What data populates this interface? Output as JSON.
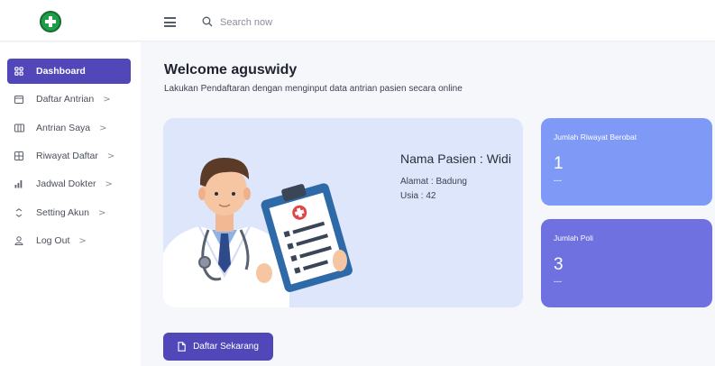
{
  "header": {
    "logo_icon": "medical-cross-logo",
    "menu_icon": "hamburger-icon",
    "search": {
      "placeholder": "Search now",
      "value": ""
    }
  },
  "sidebar": {
    "items": [
      {
        "label": "Dashboard",
        "icon": "grid-icon",
        "active": true
      },
      {
        "label": "Daftar Antrian",
        "icon": "calendar-icon",
        "chevron": ">"
      },
      {
        "label": "Antrian Saya",
        "icon": "columns-icon",
        "chevron": ">"
      },
      {
        "label": "Riwayat Daftar",
        "icon": "table-icon",
        "chevron": ">"
      },
      {
        "label": "Jadwal Dokter",
        "icon": "bar-chart-icon",
        "chevron": ">"
      },
      {
        "label": "Setting Akun",
        "icon": "settings-arrows-icon",
        "chevron": ">"
      },
      {
        "label": "Log Out",
        "icon": "user-icon",
        "chevron": ">"
      }
    ]
  },
  "main": {
    "title": "Welcome aguswidy",
    "subtitle": "Lakukan Pendaftaran dengan menginput data antrian pasien secara online",
    "patient": {
      "name": "Nama Pasien : Widi",
      "address": "Alamat : Badung",
      "age": "Usia : 42"
    },
    "cta_label": "Daftar Sekarang"
  },
  "stats": [
    {
      "title": "Jumlah Riwayat Berobat",
      "value": "1",
      "dash": "---",
      "color": "#7f9af6"
    },
    {
      "title": "Jumlah Poli",
      "value": "3",
      "dash": "---",
      "color": "#6f71e0"
    }
  ],
  "colors": {
    "accent": "#5147b8",
    "hero_bg": "#dde6fb"
  }
}
